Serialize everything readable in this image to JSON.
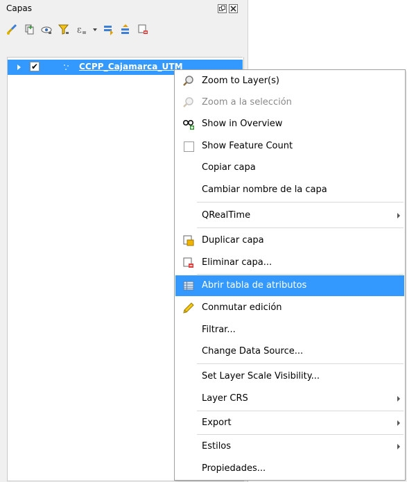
{
  "panel": {
    "title": "Capas",
    "title_buttons": [
      "float-icon",
      "close-icon"
    ],
    "toolbar": [
      "style-brush-icon",
      "add-group-icon",
      "visibility-eye-icon",
      "filter-funnel-icon",
      "expression-filter-icon",
      "dropdown-icon",
      "expand-all-icon",
      "collapse-all-icon",
      "remove-layer-icon"
    ]
  },
  "layer": {
    "name": "CCPP_Cajamarca_UTM",
    "checked": "✔"
  },
  "menu": {
    "items": [
      {
        "label": "Zoom to Layer(s)",
        "icon": "zoom-layer-icon"
      },
      {
        "label": "Zoom a la selección",
        "icon": "zoom-selection-icon",
        "disabled": true
      },
      {
        "label": "Show in Overview",
        "icon": "overview-icon"
      },
      {
        "label": "Show Feature Count",
        "icon": "checkbox-icon"
      },
      {
        "label": "Copiar capa",
        "icon": ""
      },
      {
        "label": "Cambiar nombre de la capa",
        "icon": ""
      },
      {
        "label": "QRealTime",
        "icon": "",
        "submenu": true
      },
      {
        "label": "Duplicar capa",
        "icon": "duplicate-layer-icon"
      },
      {
        "label": "Eliminar capa...",
        "icon": "remove-layer-icon"
      },
      {
        "label": "Abrir tabla de atributos",
        "icon": "attribute-table-icon",
        "highlighted": true
      },
      {
        "label": "Conmutar edición",
        "icon": "pencil-icon"
      },
      {
        "label": "Filtrar...",
        "icon": ""
      },
      {
        "label": "Change Data Source...",
        "icon": ""
      },
      {
        "label": "Set Layer Scale Visibility...",
        "icon": ""
      },
      {
        "label": "Layer CRS",
        "icon": "",
        "submenu": true
      },
      {
        "label": "Export",
        "icon": "",
        "submenu": true
      },
      {
        "label": "Estilos",
        "icon": "",
        "submenu": true
      },
      {
        "label": "Propiedades...",
        "icon": ""
      }
    ]
  },
  "colors": {
    "selection": "#3399ff",
    "panel_bg": "#f0f0f0",
    "disabled_text": "#8a8a8a"
  }
}
